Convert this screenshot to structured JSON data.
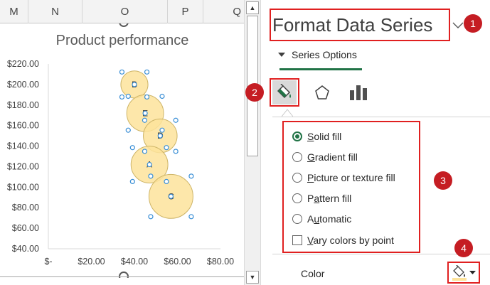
{
  "sheet": {
    "columns": [
      "M",
      "N",
      "O",
      "P",
      "Q"
    ]
  },
  "chart_data": {
    "type": "scatter",
    "title": "Product performance",
    "xlabel": "",
    "ylabel": "",
    "xlim": [
      0,
      80
    ],
    "ylim": [
      40,
      220
    ],
    "x_ticks": [
      0,
      20,
      40,
      60,
      80
    ],
    "x_tick_labels": [
      "$-",
      "$20.00",
      "$40.00",
      "$60.00",
      "$80.00"
    ],
    "y_ticks": [
      40,
      60,
      80,
      100,
      120,
      140,
      160,
      180,
      200,
      220
    ],
    "y_tick_labels": [
      "$40.00",
      "$60.00",
      "$80.00",
      "$100.00",
      "$120.00",
      "$140.00",
      "$160.00",
      "$180.00",
      "$200.00",
      "$220.00"
    ],
    "grid": false,
    "series_color": "#fde39b",
    "series_edge_color": "#cdb467",
    "bubble_size_unit": "relative",
    "points": [
      {
        "label": "B",
        "x": 40,
        "y": 200,
        "size": 0.53
      },
      {
        "label": "E",
        "x": 45,
        "y": 172,
        "size": 0.72
      },
      {
        "label": "D",
        "x": 52,
        "y": 150,
        "size": 0.66
      },
      {
        "label": "A",
        "x": 47,
        "y": 122,
        "size": 0.72
      },
      {
        "label": "C",
        "x": 57,
        "y": 91,
        "size": 0.86
      }
    ]
  },
  "pane": {
    "title": "Format Data Series",
    "section": "Series Options",
    "fill_options": [
      {
        "label": "Solid fill",
        "mnemonic": "S",
        "checked": true
      },
      {
        "label": "Gradient fill",
        "mnemonic": "G",
        "checked": false
      },
      {
        "label": "Picture or texture fill",
        "mnemonic": "P",
        "checked": false
      },
      {
        "label": "Pattern fill",
        "mnemonic": "a",
        "checked": false
      },
      {
        "label": "Automatic",
        "mnemonic": "u",
        "checked": false
      }
    ],
    "vary_colors": {
      "label": "Vary colors by point",
      "mnemonic": "V",
      "checked": false
    },
    "color_label": "Color",
    "color_swatch": "#fde39b"
  },
  "annotations": {
    "badges": [
      "1",
      "2",
      "3",
      "4"
    ],
    "highlight_color": "#e02020",
    "badge_color": "#c51d23"
  },
  "colors": {
    "accent": "#217346"
  }
}
